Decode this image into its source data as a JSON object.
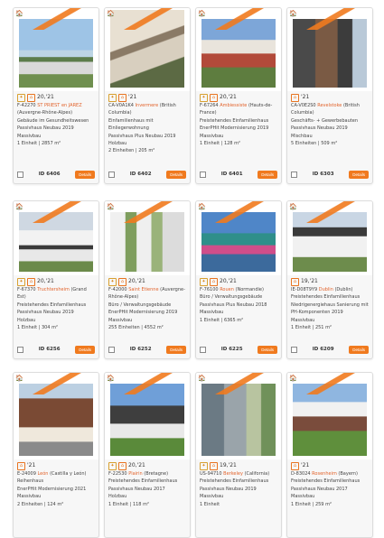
{
  "colors": {
    "accent": "#f07a1e",
    "city": "#e2622a"
  },
  "cards": [
    {
      "year": "20,'21",
      "loc_pre": "F-42270 ",
      "city": "ST PRIEST en JAREZ",
      "loc_post": " (Auvergne-Rhône-Alpes)",
      "lines": [
        "Gebäude im Gesundheitswesen",
        "Passivhaus Neubau 2019",
        "Massivbau",
        "1 Einheit | 2857 m²"
      ],
      "id": "ID 6406",
      "details": "Details"
    },
    {
      "year": "'21",
      "loc_pre": "CA-V0A1K4 ",
      "city": "Invermere",
      "loc_post": " (British Columbia)",
      "lines": [
        "Einfamilienhaus mit Einliegerwohnung",
        "Passivhaus Plus Neubau 2019",
        "Holzbau",
        "2 Einheiten | 205 m²"
      ],
      "id": "ID 6402",
      "details": "Details"
    },
    {
      "year": "20,'21",
      "loc_pre": "F-67264 ",
      "city": "Ambiessiste",
      "loc_post": " (Hauts-de-France)",
      "lines": [
        "Freistehendes Einfamilienhaus",
        "EnerPHit Modernisierung 2019",
        "Massivbau",
        "1 Einheit | 128 m²"
      ],
      "id": "ID 6401",
      "details": "Details"
    },
    {
      "year": "'21",
      "loc_pre": "CA-V0E2S0 ",
      "city": "Revelstoke",
      "loc_post": " (British Columbia)",
      "lines": [
        "Geschäfts- + Gewerbebauten",
        "Passivhaus Neubau 2019",
        "Mischbau",
        "5 Einheiten | 509 m²"
      ],
      "id": "ID 6303",
      "details": "Details"
    },
    {
      "year": "20,'21",
      "loc_pre": "F-67370 ",
      "city": "Truchtersheim",
      "loc_post": " (Grand Est)",
      "lines": [
        "Freistehendes Einfamilienhaus",
        "Passivhaus Neubau 2019",
        "Holzbau",
        "1 Einheit | 304 m²"
      ],
      "id": "ID 6256",
      "details": "Details"
    },
    {
      "year": "20,'21",
      "loc_pre": "F-42000 ",
      "city": "Saint Etienne",
      "loc_post": " (Auvergne-Rhône-Alpes)",
      "lines": [
        "Büro / Verwaltungsgebäude",
        "EnerPHit Modernisierung 2019",
        "Massivbau",
        "255 Einheiten | 4552 m²"
      ],
      "id": "ID 6252",
      "details": "Details"
    },
    {
      "year": "20,'21",
      "loc_pre": "F-76100 ",
      "city": "Rouen",
      "loc_post": " (Normandie)",
      "lines": [
        "Büro / Verwaltungsgebäude",
        "Passivhaus Plus Neubau 2018",
        "Massivbau",
        "1 Einheit | 6365 m²"
      ],
      "id": "ID 6225",
      "details": "Details"
    },
    {
      "year": "19,'21",
      "loc_pre": "IE-D08T9Y9 ",
      "city": "Dublin",
      "loc_post": " (Dublin)",
      "lines": [
        "Freistehendes Einfamilienhaus",
        "Niedrigenergiehaus Sanierung mit PH-Komponenten 2019",
        "Massivbau",
        "1 Einheit | 251 m²"
      ],
      "id": "ID 6209",
      "details": "Details"
    },
    {
      "year": "'21",
      "loc_pre": "E-24009 ",
      "city": "León",
      "loc_post": " (Castilla y León)",
      "lines": [
        "Reihenhaus",
        "EnerPHit Modernisierung 2021",
        "Massivbau",
        "2 Einheiten | 124 m²"
      ],
      "id": "",
      "details": ""
    },
    {
      "year": "20,'21",
      "loc_pre": "F-22530 ",
      "city": "Plairin",
      "loc_post": " (Bretagne)",
      "lines": [
        "Freistehendes Einfamilienhaus",
        "Passivhaus Neubau 2017",
        "Holzbau",
        "1 Einheit | 118 m²"
      ],
      "id": "",
      "details": ""
    },
    {
      "year": "19,'21",
      "loc_pre": "US-94710 ",
      "city": "Berkeley",
      "loc_post": " (California)",
      "lines": [
        "Freistehendes Einfamilienhaus",
        "Passivhaus Neubau 2019",
        "Massivbau",
        "1 Einheit"
      ],
      "id": "",
      "details": ""
    },
    {
      "year": "'21",
      "loc_pre": "D-83024 ",
      "city": "Rosenheim",
      "loc_post": " (Bayern)",
      "lines": [
        "Freistehendes Einfamilienhaus",
        "Passivhaus Neubau 2017",
        "Massivbau",
        "1 Einheit | 259 m²"
      ],
      "id": "",
      "details": ""
    }
  ]
}
